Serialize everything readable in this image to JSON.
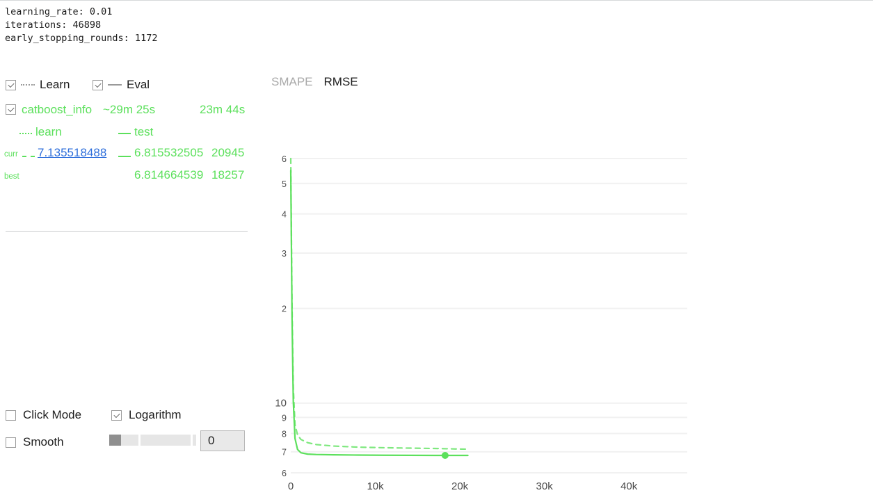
{
  "params": {
    "lines": [
      "learning_rate: 0.01",
      "iterations: 46898",
      "early_stopping_rounds: 1172"
    ],
    "text": "learning_rate: 0.01\niterations: 46898\nearly_stopping_rounds: 1172"
  },
  "series_toggles": {
    "learn": {
      "label": "Learn",
      "checked": true,
      "line_style": "dotted"
    },
    "eval": {
      "label": "Eval",
      "checked": true,
      "line_style": "solid"
    }
  },
  "metrics": {
    "run": {
      "checked": true,
      "name": "catboost_info",
      "eta": "~29m 25s",
      "elapsed": "23m 44s",
      "color": "#5ce05c"
    },
    "headers": {
      "learn": "learn",
      "test": "test"
    },
    "curr": {
      "tag": "curr",
      "learn_value": "7.135518488",
      "test_value": "6.815532505",
      "iteration": "20945"
    },
    "best": {
      "tag": "best",
      "test_value": "6.814664539",
      "iteration": "18257"
    }
  },
  "controls": {
    "click_mode": {
      "label": "Click Mode",
      "checked": false
    },
    "logarithm": {
      "label": "Logarithm",
      "checked": true
    },
    "smooth": {
      "label": "Smooth",
      "checked": false
    },
    "smooth_slider_value": "0"
  },
  "chart_tabs": [
    {
      "label": "SMAPE",
      "active": false
    },
    {
      "label": "RMSE",
      "active": true
    }
  ],
  "chart_data": {
    "type": "line",
    "title": "RMSE",
    "xlabel": "",
    "ylabel": "",
    "log_y": true,
    "grid": true,
    "legend_position": "left-panel",
    "xlim": [
      0,
      46898
    ],
    "ylim": [
      6,
      60
    ],
    "xticks": [
      0,
      10000,
      20000,
      30000,
      40000
    ],
    "xticklabels": [
      "0",
      "10k",
      "20k",
      "30k",
      "40k"
    ],
    "yticks": [
      60,
      50,
      40,
      30,
      20,
      10,
      9,
      8,
      7,
      6
    ],
    "yticklabels": [
      "6",
      "5",
      "4",
      "3",
      "2",
      "10",
      "9",
      "8",
      "7",
      "6"
    ],
    "series": [
      {
        "name": "learn",
        "style": "dashed",
        "color": "#7ee87e",
        "x": [
          0,
          150,
          300,
          500,
          800,
          1200,
          2000,
          3000,
          5000,
          8000,
          11000,
          14000,
          17000,
          20000,
          20945
        ],
        "y": [
          60,
          20.5,
          11.2,
          8.55,
          7.92,
          7.66,
          7.48,
          7.38,
          7.3,
          7.24,
          7.21,
          7.19,
          7.17,
          7.14,
          7.135518488
        ]
      },
      {
        "name": "test",
        "style": "solid",
        "color": "#5ce05c",
        "x": [
          0,
          150,
          300,
          500,
          800,
          1200,
          2000,
          3000,
          5000,
          8000,
          11000,
          14000,
          17000,
          18257,
          20000,
          20945
        ],
        "y": [
          55,
          18.6,
          10.1,
          7.72,
          7.12,
          6.95,
          6.88,
          6.86,
          6.845,
          6.832,
          6.824,
          6.819,
          6.816,
          6.814664539,
          6.8152,
          6.815532505
        ]
      }
    ],
    "markers": [
      {
        "series": "test",
        "x": 18257,
        "y": 6.814664539,
        "kind": "best-point",
        "color": "#5ce05c"
      }
    ]
  }
}
